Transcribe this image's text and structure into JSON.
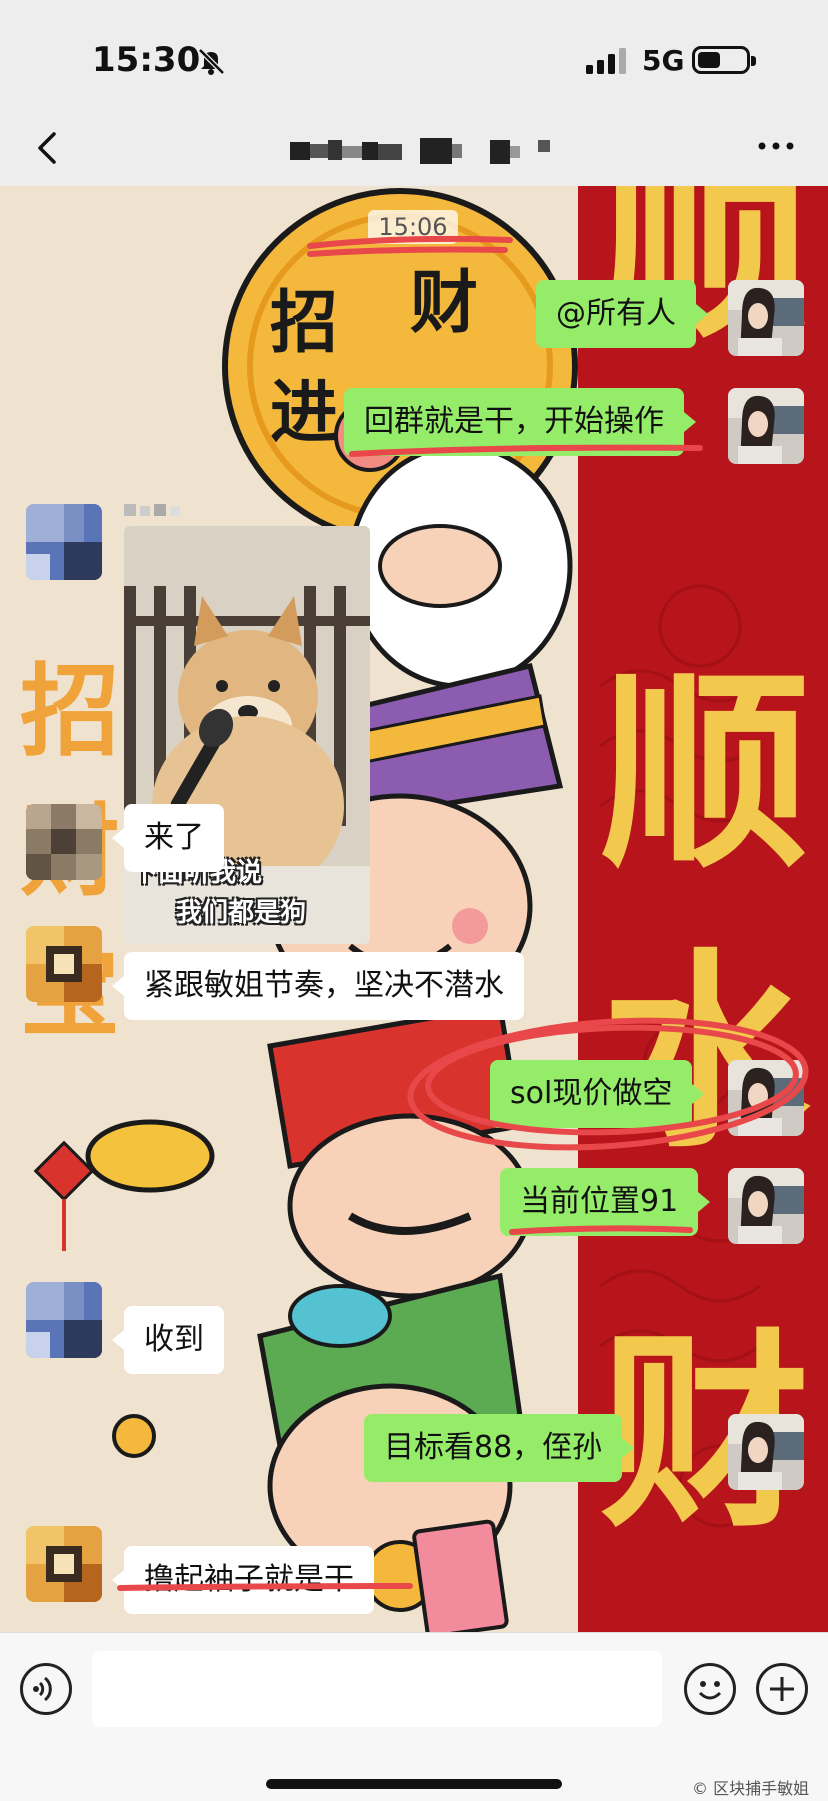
{
  "status_bar": {
    "time": "15:30",
    "network": "5G"
  },
  "nav": {
    "title": "",
    "back_icon": "chevron-left-icon",
    "more_icon": "more-dots-icon"
  },
  "chat": {
    "timestamp": "15:06",
    "messages": [
      {
        "id": "m1",
        "side": "out",
        "type": "text",
        "text": "@所有人"
      },
      {
        "id": "m2",
        "side": "out",
        "type": "text",
        "text": "回群就是干，开始操作"
      },
      {
        "id": "m3",
        "side": "in",
        "type": "sticker",
        "caption_line1": "下面听我说",
        "caption_line2": "我们都是狗"
      },
      {
        "id": "m4",
        "side": "in",
        "type": "text",
        "text": "来了"
      },
      {
        "id": "m5",
        "side": "in",
        "type": "text",
        "text": "紧跟敏姐节奏，坚决不潜水"
      },
      {
        "id": "m6",
        "side": "out",
        "type": "text",
        "text": "sol现价做空"
      },
      {
        "id": "m7",
        "side": "out",
        "type": "text",
        "text": "当前位置91"
      },
      {
        "id": "m8",
        "side": "in",
        "type": "text",
        "text": "收到"
      },
      {
        "id": "m9",
        "side": "out",
        "type": "text",
        "text": "目标看88，侄孙"
      },
      {
        "id": "m10",
        "side": "in",
        "type": "text",
        "text": "撸起袖子就是干"
      }
    ]
  },
  "background_art": {
    "left_chars": [
      "招",
      "财",
      "进",
      "宝"
    ],
    "right_chars": [
      "顺",
      "顺",
      "水",
      "财"
    ]
  },
  "input_bar": {
    "placeholder": "",
    "icons": [
      "voice-icon",
      "emoji-icon",
      "plus-icon"
    ]
  },
  "watermark": "区块捕手敏姐",
  "colors": {
    "outgoing_bubble": "#95ec69",
    "incoming_bubble": "#ffffff",
    "highlight_mark": "#e8484a",
    "banner_red": "#b8141b"
  }
}
